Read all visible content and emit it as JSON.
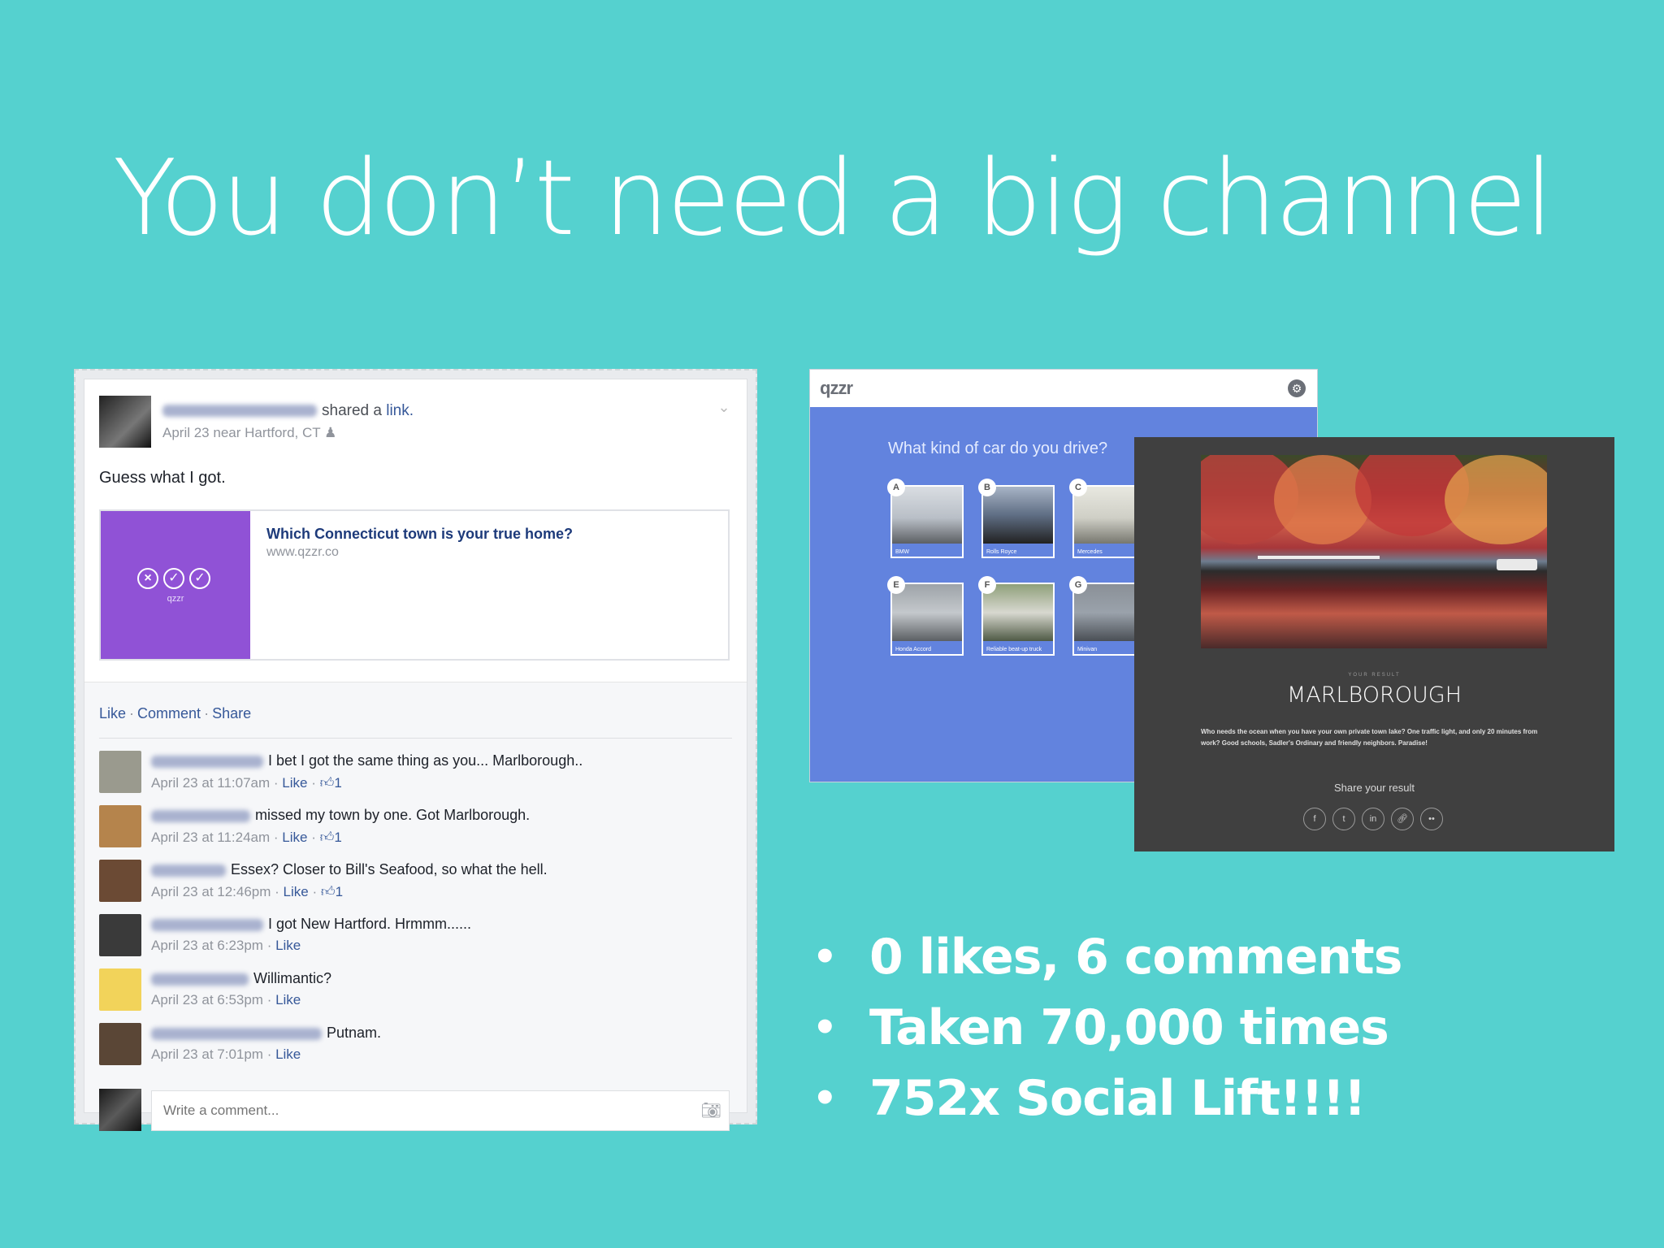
{
  "slide": {
    "title": "You don’t need a big channel",
    "bullets": [
      "0 likes, 6 comments",
      "Taken 70,000 times",
      "752x Social Lift!!!!"
    ]
  },
  "fb_post": {
    "shared_text": "shared a",
    "shared_link": "link.",
    "meta": "April 23 near Hartford, CT",
    "message": "Guess what I got.",
    "link_card": {
      "title": "Which Connecticut town is your true home?",
      "url": "www.qzzr.co",
      "thumb_brand": "qzzr"
    },
    "actions": [
      "Like",
      "Comment",
      "Share"
    ],
    "comments": [
      {
        "text": "I bet I got the same thing as you... Marlborough..",
        "time": "April 23 at 11:07am",
        "like": "Like",
        "likes": "1",
        "avatar_color": "#9a9a8e"
      },
      {
        "text": "missed my town by one. Got Marlborough.",
        "time": "April 23 at 11:24am",
        "like": "Like",
        "likes": "1",
        "avatar_color": "#b5844c"
      },
      {
        "text": "Essex? Closer to Bill's Seafood, so what the hell.",
        "time": "April 23 at 12:46pm",
        "like": "Like",
        "likes": "1",
        "avatar_color": "#6b4a34"
      },
      {
        "text": "I got New Hartford. Hrmmm......",
        "time": "April 23 at 6:23pm",
        "like": "Like",
        "likes": "",
        "avatar_color": "#3a3a3a"
      },
      {
        "text": "Willimantic?",
        "time": "April 23 at 6:53pm",
        "like": "Like",
        "likes": "",
        "avatar_color": "#f2d35a"
      },
      {
        "text": "Putnam.",
        "time": "April 23 at 7:01pm",
        "like": "Like",
        "likes": "",
        "avatar_color": "#5a4636"
      }
    ],
    "write_placeholder": "Write a comment..."
  },
  "qzzr": {
    "logo": "qzzr",
    "question": "What kind of car do you drive?",
    "answers": [
      {
        "badge": "A",
        "label": "BMW",
        "color": "#b9bfc7"
      },
      {
        "badge": "B",
        "label": "Rolls Royce",
        "color": "#5f6e84"
      },
      {
        "badge": "C",
        "label": "Mercedes",
        "color": "#cfcfc6"
      },
      {
        "badge": "E",
        "label": "Honda Accord",
        "color": "#c4c8cc"
      },
      {
        "badge": "F",
        "label": "Reliable beat-up truck",
        "color": "#8fa07a"
      },
      {
        "badge": "G",
        "label": "Minivan",
        "color": "#9aa2ab"
      }
    ]
  },
  "result": {
    "small_label": "YOUR RESULT",
    "name": "MARLBOROUGH",
    "description": "Who needs the ocean when you have your own private town lake? One traffic light, and only 20 minutes from work? Good schools, Sadler's Ordinary and friendly neighbors. Paradise!",
    "share_label": "Share your result",
    "share_icons": [
      "f",
      "t",
      "in",
      "link",
      "••"
    ]
  }
}
